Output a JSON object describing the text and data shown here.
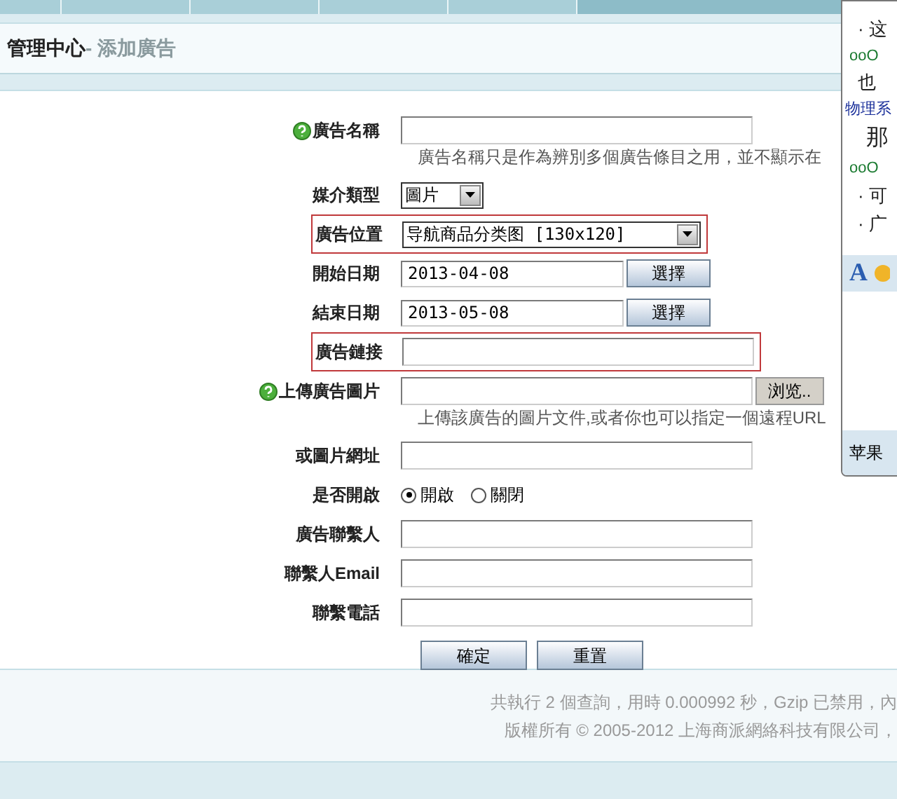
{
  "breadcrumb": {
    "title": "管理中心",
    "current": "- 添加廣告"
  },
  "form": {
    "rows": [
      {
        "kind": "text",
        "label": "廣告名稱",
        "help": true,
        "highlighted": false,
        "value": "",
        "hint": "廣告名稱只是作為辨別多個廣告條目之用，並不顯示在"
      },
      {
        "kind": "select",
        "label": "媒介類型",
        "help": false,
        "highlighted": false,
        "value": "圖片",
        "wide": false
      },
      {
        "kind": "select",
        "label": "廣告位置",
        "help": false,
        "highlighted": true,
        "value": "导航商品分类图 [130x120]",
        "wide": true
      },
      {
        "kind": "date",
        "label": "開始日期",
        "help": false,
        "highlighted": false,
        "value": "2013-04-08",
        "button": "選擇"
      },
      {
        "kind": "date",
        "label": "結束日期",
        "help": false,
        "highlighted": false,
        "value": "2013-05-08",
        "button": "選擇"
      },
      {
        "kind": "text",
        "label": "廣告鏈接",
        "help": false,
        "highlighted": true,
        "value": ""
      },
      {
        "kind": "file",
        "label": "上傳廣告圖片",
        "help": true,
        "highlighted": false,
        "button": "浏览..",
        "hint": "上傳該廣告的圖片文件,或者你也可以指定一個遠程URL"
      },
      {
        "kind": "text",
        "label": "或圖片網址",
        "help": false,
        "highlighted": false,
        "value": ""
      },
      {
        "kind": "radio",
        "label": "是否開啟",
        "help": false,
        "highlighted": false,
        "options": [
          {
            "label": "開啟",
            "selected": true
          },
          {
            "label": "關閉",
            "selected": false
          }
        ]
      },
      {
        "kind": "text",
        "label": "廣告聯繫人",
        "help": false,
        "highlighted": false,
        "value": ""
      },
      {
        "kind": "text",
        "label": "聯繫人Email",
        "help": false,
        "highlighted": false,
        "value": ""
      },
      {
        "kind": "text",
        "label": "聯繫電話",
        "help": false,
        "highlighted": false,
        "value": ""
      }
    ],
    "buttons": [
      "確定",
      "重置"
    ]
  },
  "footer": [
    "共執行 2 個查詢，用時 0.000992 秒，Gzip 已禁用，內",
    "版權所有 © 2005-2012 上海商派網絡科技有限公司，"
  ],
  "chat_panel": {
    "lines": [
      {
        "kind": "message",
        "text": "· 这"
      },
      {
        "kind": "sender",
        "text": "ooO"
      },
      {
        "kind": "message",
        "text": "也"
      },
      {
        "kind": "link",
        "text": "物理系"
      },
      {
        "kind": "big",
        "text": "那"
      },
      {
        "kind": "sender",
        "text": "ooO"
      },
      {
        "kind": "message",
        "text": "· 可"
      },
      {
        "kind": "message",
        "text": "· 广"
      }
    ],
    "toolbar_letter": "A",
    "bottom": "苹果"
  }
}
